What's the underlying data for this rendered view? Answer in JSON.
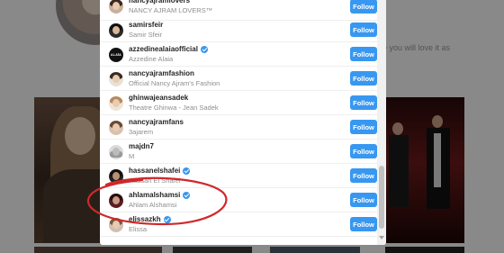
{
  "background": {
    "bio_fragment": "e you will love it as"
  },
  "modal": {
    "rows": [
      {
        "username": "nancyajramlovers",
        "fullname": "NANCY AJRAM LOVERS™",
        "verified": false,
        "follow_label": "Follow",
        "avatar_text": ""
      },
      {
        "username": "samirsfeir",
        "fullname": "Samir Sfeir",
        "verified": false,
        "follow_label": "Follow",
        "avatar_text": ""
      },
      {
        "username": "azzedinealaiaofficial",
        "fullname": "Azzedine Alaia",
        "verified": true,
        "follow_label": "Follow",
        "avatar_text": "ALAÏA"
      },
      {
        "username": "nancyajramfashion",
        "fullname": "Official Nancy Ajram's Fashion",
        "verified": false,
        "follow_label": "Follow",
        "avatar_text": ""
      },
      {
        "username": "ghinwajeansadek",
        "fullname": "Theatre Ghinwa - Jean Sadek",
        "verified": false,
        "follow_label": "Follow",
        "avatar_text": ""
      },
      {
        "username": "nancyajramfans",
        "fullname": "3ajarem",
        "verified": false,
        "follow_label": "Follow",
        "avatar_text": ""
      },
      {
        "username": "majdn7",
        "fullname": "M",
        "verified": false,
        "follow_label": "Follow",
        "avatar_text": ""
      },
      {
        "username": "hassanelshafei",
        "fullname": "Hassan El Shafei",
        "verified": true,
        "follow_label": "Follow",
        "avatar_text": ""
      },
      {
        "username": "ahlamalshamsi",
        "fullname": "Ahlam Alshamsi",
        "verified": true,
        "follow_label": "Follow",
        "avatar_text": ""
      },
      {
        "username": "elissazkh",
        "fullname": "Elissa",
        "verified": true,
        "follow_label": "Follow",
        "avatar_text": ""
      }
    ]
  },
  "colors": {
    "follow_button": "#3897f0",
    "verified_badge": "#3897f0",
    "annotation_circle": "#d0282a"
  }
}
